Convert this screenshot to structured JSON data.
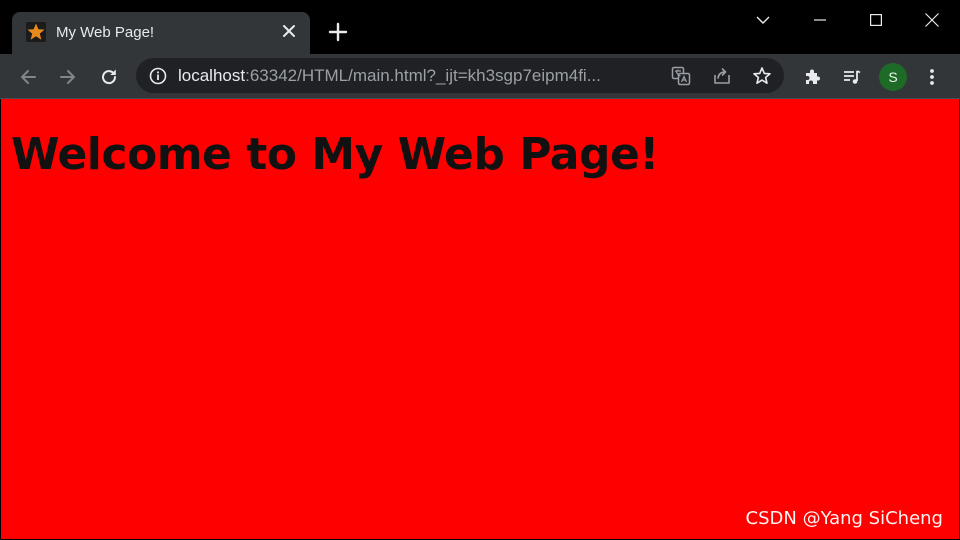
{
  "tab": {
    "title": "My Web Page!",
    "favicon": "star-icon"
  },
  "omnibox": {
    "host": "localhost",
    "rest": ":63342/HTML/main.html?_ijt=kh3sgp7eipm4fi..."
  },
  "profile": {
    "initial": "S"
  },
  "page": {
    "heading": "Welcome to My Web Page!",
    "background": "#ff0000"
  },
  "watermark": "CSDN @Yang SiCheng",
  "colors": {
    "titlebar": "#000000",
    "toolbar": "#323639",
    "omnibox": "#202124",
    "avatar": "#1e6b28"
  }
}
